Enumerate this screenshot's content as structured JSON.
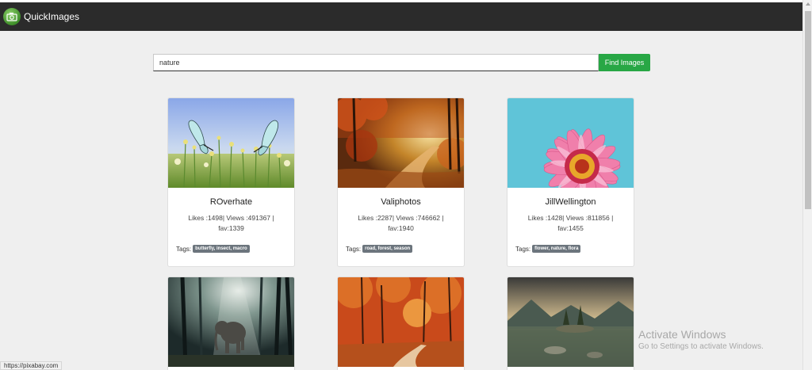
{
  "app": {
    "brand": "QuickImages"
  },
  "search": {
    "value": "nature",
    "button_label": "Find Images"
  },
  "cards": [
    {
      "user": "ROverhate",
      "stats_line1": "Likes :1498| Views :491367 |",
      "stats_line2": "fav:1339",
      "tags_label": "Tags:",
      "tags": "butterfly, insect, macro"
    },
    {
      "user": "Valiphotos",
      "stats_line1": "Likes :2287| Views :746662 |",
      "stats_line2": "fav:1940",
      "tags_label": "Tags:",
      "tags": "road, forest, season"
    },
    {
      "user": "JillWellington",
      "stats_line1": "Likes :1428| Views :811856 |",
      "stats_line2": "fav:1455",
      "tags_label": "Tags:",
      "tags": "flower, nature, flora"
    }
  ],
  "status_url": "https://pixabay.com",
  "watermark": {
    "title": "Activate Windows",
    "subtitle": "Go to Settings to activate Windows."
  }
}
